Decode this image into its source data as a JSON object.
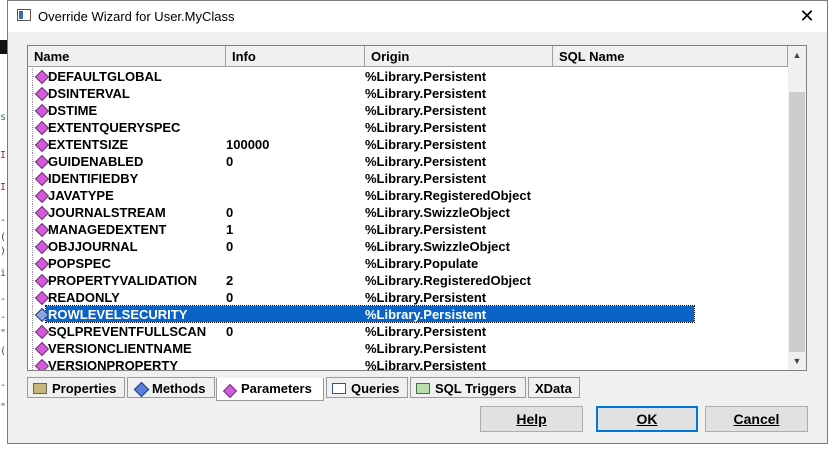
{
  "background": {
    "left_marks": [
      "s",
      "I",
      "I",
      "-",
      "(",
      ")",
      "i",
      "-",
      "-",
      "\"",
      "(",
      "-",
      "\""
    ],
    "right_mark": ")"
  },
  "dialog": {
    "title": "Override Wizard for User.MyClass",
    "close_glyph": "✕"
  },
  "list": {
    "columns": [
      "Name",
      "Info",
      "Origin",
      "SQL Name"
    ],
    "rows": [
      {
        "name": "DEFAULTGLOBAL",
        "info": "",
        "origin": "%Library.Persistent"
      },
      {
        "name": "DSINTERVAL",
        "info": "",
        "origin": "%Library.Persistent"
      },
      {
        "name": "DSTIME",
        "info": "",
        "origin": "%Library.Persistent"
      },
      {
        "name": "EXTENTQUERYSPEC",
        "info": "",
        "origin": "%Library.Persistent"
      },
      {
        "name": "EXTENTSIZE",
        "info": "100000",
        "origin": "%Library.Persistent"
      },
      {
        "name": "GUIDENABLED",
        "info": "0",
        "origin": "%Library.Persistent"
      },
      {
        "name": "IDENTIFIEDBY",
        "info": "",
        "origin": "%Library.Persistent"
      },
      {
        "name": "JAVATYPE",
        "info": "",
        "origin": "%Library.RegisteredObject"
      },
      {
        "name": "JOURNALSTREAM",
        "info": "0",
        "origin": "%Library.SwizzleObject"
      },
      {
        "name": "MANAGEDEXTENT",
        "info": "1",
        "origin": "%Library.Persistent"
      },
      {
        "name": "OBJJOURNAL",
        "info": "0",
        "origin": "%Library.SwizzleObject"
      },
      {
        "name": "POPSPEC",
        "info": "",
        "origin": "%Library.Populate"
      },
      {
        "name": "PROPERTYVALIDATION",
        "info": "2",
        "origin": "%Library.RegisteredObject"
      },
      {
        "name": "READONLY",
        "info": "0",
        "origin": "%Library.Persistent"
      },
      {
        "name": "ROWLEVELSECURITY",
        "info": "",
        "origin": "%Library.Persistent",
        "selected": true
      },
      {
        "name": "SQLPREVENTFULLSCAN",
        "info": "0",
        "origin": "%Library.Persistent"
      },
      {
        "name": "VERSIONCLIENTNAME",
        "info": "",
        "origin": "%Library.Persistent"
      },
      {
        "name": "VERSIONPROPERTY",
        "info": "",
        "origin": "%Library.Persistent"
      }
    ],
    "scroll_up_glyph": "▲",
    "scroll_down_glyph": "▼"
  },
  "tabs": [
    {
      "label": "Properties",
      "icon": "properties-icon",
      "active": false
    },
    {
      "label": "Methods",
      "icon": "methods-icon",
      "active": false
    },
    {
      "label": "Parameters",
      "icon": "parameters-icon",
      "active": true
    },
    {
      "label": "Queries",
      "icon": "queries-icon",
      "active": false
    },
    {
      "label": "SQL Triggers",
      "icon": "sql-triggers-icon",
      "active": false
    },
    {
      "label": "XData",
      "icon": "",
      "active": false
    }
  ],
  "buttons": {
    "help": "Help",
    "ok": "OK",
    "cancel": "Cancel"
  },
  "colors": {
    "selection": "#0a64c8",
    "parameter_icon": "#d15cd7"
  }
}
